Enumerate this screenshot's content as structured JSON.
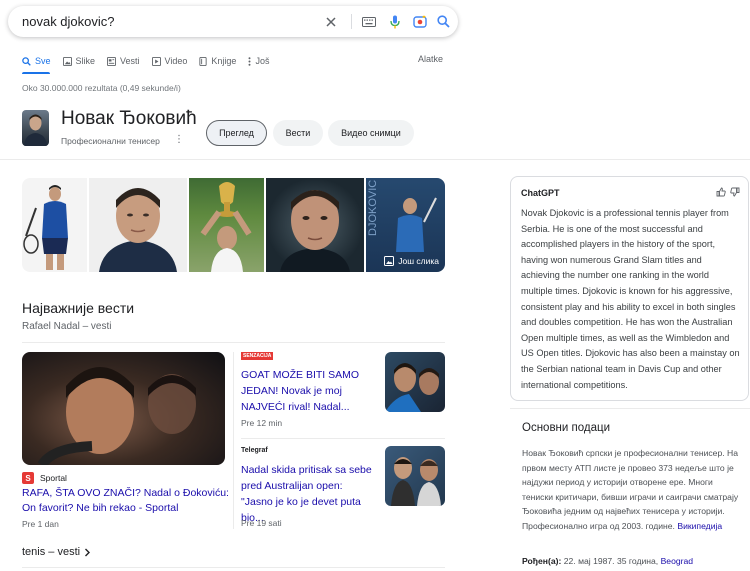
{
  "search": {
    "query": "novak djokovic?"
  },
  "tabs": [
    {
      "label": "Sve",
      "icon": "search-icon",
      "active": true
    },
    {
      "label": "Slike",
      "icon": "image-icon"
    },
    {
      "label": "Vesti",
      "icon": "news-icon"
    },
    {
      "label": "Video",
      "icon": "video-icon"
    },
    {
      "label": "Knjige",
      "icon": "book-icon"
    },
    {
      "label": "Još",
      "icon": "more-vert-icon"
    }
  ],
  "tools_label": "Alatke",
  "result_stats": "Oko 30.000.000 rezultata (0,49 sekunde/i)",
  "entity": {
    "name": "Новак Ђоковић",
    "subtitle": "Професионални тенисер",
    "chips": [
      "Преглед",
      "Вести",
      "Видео снимци"
    ]
  },
  "images": {
    "more_label": "Још слика"
  },
  "news": {
    "title": "Најважније вести",
    "subtitle": "Rafael Nadal – vesti",
    "main": {
      "source": "Sportal",
      "headline": "RAFA, ŠTA OVO ZNAČI? Nadal o Đokoviću: On favorit? Ne bih rekao - Sportal",
      "time": "Pre 1 dan"
    },
    "items": [
      {
        "source": "SENZACIJA",
        "headline": "GOAT MOŽE BITI SAMO JEDAN! Novak je moj NAJVEĆI rival! Nadal...",
        "time": "Pre 12 min"
      },
      {
        "source": "Telegraf",
        "headline": "Nadal skida pritisak sa sebe pred Australijan open: \"Jasno je ko je devet puta bio...",
        "time": "Pre 19 sati"
      }
    ],
    "more_label": "tenis – vesti"
  },
  "chatgpt": {
    "title": "ChatGPT",
    "text": "Novak Djokovic is a professional tennis player from Serbia. He is one of the most successful and accomplished players in the history of the sport, having won numerous Grand Slam titles and achieving the number one ranking in the world multiple times. Djokovic is known for his aggressive, consistent play and his ability to excel in both singles and doubles competition. He has won the Australian Open multiple times, as well as the Wimbledon and US Open titles. Djokovic has also been a mainstay on the Serbian national team in Davis Cup and other international competitions."
  },
  "knowledge": {
    "title": "Основни подаци",
    "description": "Новак Ђоковић српски је професионални тенисер. На првом месту АТП листе је провео 373 недеље што је најдужи период у историји отворене ере. Многи тениски критичари, бивши играчи и саиграчи сматрају Ђоковића једним од највећих тенисера у историји. Професионално игра од 2003. године.",
    "wiki_label": "Википедија",
    "born_label": "Рођен(а):",
    "born_value": "22. мај 1987. 35 година,",
    "born_place": "Beograd"
  },
  "colors": {
    "link": "#1a0dab",
    "accent": "#1a73e8",
    "mic": "#4285f4"
  }
}
